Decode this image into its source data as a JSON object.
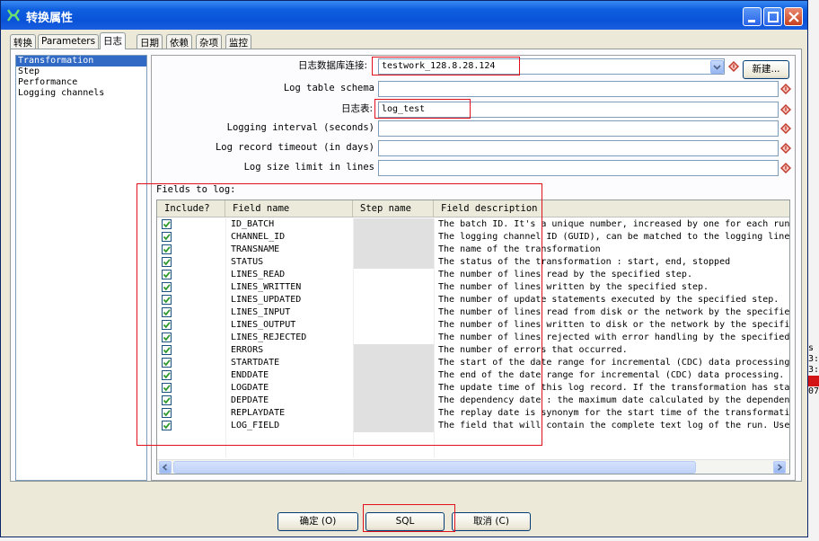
{
  "window": {
    "title": "转换属性",
    "controls": [
      "minimize-icon",
      "maximize-icon",
      "close-icon"
    ]
  },
  "tabs": [
    {
      "label": "转换",
      "active": false
    },
    {
      "label": "Parameters",
      "active": false
    },
    {
      "label": "日志",
      "active": true
    },
    {
      "label": "日期",
      "active": false
    },
    {
      "label": "依赖",
      "active": false
    },
    {
      "label": "杂项",
      "active": false
    },
    {
      "label": "监控",
      "active": false
    }
  ],
  "log_types": [
    "Transformation",
    "Step",
    "Performance",
    "Logging channels"
  ],
  "form": {
    "connection_label": "日志数据库连接:",
    "connection_value": "testwork_128.8.28.124",
    "new_button": "新建...",
    "schema_label": "Log table schema",
    "schema_value": "",
    "table_label": "日志表:",
    "table_value": "log_test",
    "interval_label": "Logging interval (seconds)",
    "interval_value": "",
    "timeout_label": "Log record timeout (in days)",
    "timeout_value": "",
    "size_label": "Log size limit in lines",
    "size_value": ""
  },
  "fields_grid": {
    "title": "Fields to log:",
    "columns": [
      "Include?",
      "Field name",
      "Step name",
      "Field description"
    ],
    "rows": [
      {
        "include": true,
        "field": "ID_BATCH",
        "step_enabled": false,
        "desc": "The batch ID. It's a unique number, increased by one for each run"
      },
      {
        "include": true,
        "field": "CHANNEL_ID",
        "step_enabled": false,
        "desc": "The logging channel ID (GUID), can be matched to the logging lineage"
      },
      {
        "include": true,
        "field": "TRANSNAME",
        "step_enabled": false,
        "desc": "The name of the transformation"
      },
      {
        "include": true,
        "field": "STATUS",
        "step_enabled": false,
        "desc": "The status of the transformation : start, end, stopped"
      },
      {
        "include": true,
        "field": "LINES_READ",
        "step_enabled": true,
        "desc": "The number of lines read by the specified step."
      },
      {
        "include": true,
        "field": "LINES_WRITTEN",
        "step_enabled": true,
        "desc": "The number of lines written by the specified step."
      },
      {
        "include": true,
        "field": "LINES_UPDATED",
        "step_enabled": true,
        "desc": "The number of update statements executed by the specified step."
      },
      {
        "include": true,
        "field": "LINES_INPUT",
        "step_enabled": true,
        "desc": "The number of lines read from disk or the network by the specified step."
      },
      {
        "include": true,
        "field": "LINES_OUTPUT",
        "step_enabled": true,
        "desc": "The number of lines written to disk or the network by the specified step."
      },
      {
        "include": true,
        "field": "LINES_REJECTED",
        "step_enabled": true,
        "desc": "The number of lines rejected with error handling by the specified step."
      },
      {
        "include": true,
        "field": "ERRORS",
        "step_enabled": false,
        "desc": "The number of errors that occurred."
      },
      {
        "include": true,
        "field": "STARTDATE",
        "step_enabled": false,
        "desc": "The start of the date range for incremental (CDC) data processing."
      },
      {
        "include": true,
        "field": "ENDDATE",
        "step_enabled": false,
        "desc": "The end of the date range for incremental (CDC) data processing."
      },
      {
        "include": true,
        "field": "LOGDATE",
        "step_enabled": false,
        "desc": "The update time of this log record.  If the transformation has status"
      },
      {
        "include": true,
        "field": "DEPDATE",
        "step_enabled": false,
        "desc": "The dependency date : the maximum date calculated by the dependency rules"
      },
      {
        "include": true,
        "field": "REPLAYDATE",
        "step_enabled": false,
        "desc": "The replay date is synonym for the start time of the transformation"
      },
      {
        "include": true,
        "field": "LOG_FIELD",
        "step_enabled": false,
        "desc": "The field that will contain the complete text log of the run.  Use"
      }
    ]
  },
  "buttons": {
    "ok": "确定 (O)",
    "sql": "SQL",
    "cancel": "取消 (C)"
  },
  "background_fragment": [
    "s",
    "3:",
    "3:",
    "",
    "07:"
  ],
  "colors": {
    "title_bar": "#0a52d8",
    "highlight_box": "#e0101c",
    "selection": "#316ac5",
    "check": "#2f9a2f"
  }
}
